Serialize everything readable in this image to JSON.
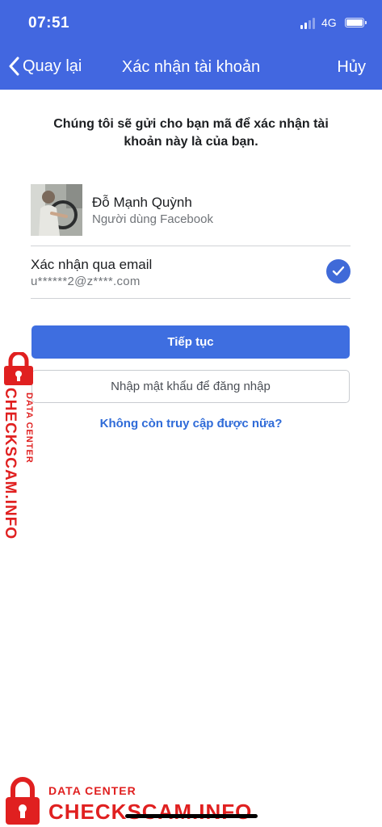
{
  "status_bar": {
    "time": "07:51",
    "network": "4G"
  },
  "nav": {
    "back_label": "Quay lại",
    "title": "Xác nhận tài khoản",
    "cancel_label": "Hủy"
  },
  "intro_text": "Chúng tôi sẽ gửi cho bạn mã để xác nhận tài khoản này là của bạn.",
  "account": {
    "name": "Đỗ Mạnh Quỳnh",
    "subtitle": "Người dùng Facebook"
  },
  "verify_option": {
    "title": "Xác nhận qua email",
    "email": "u******2@z****.com",
    "selected": true
  },
  "buttons": {
    "continue": "Tiếp tục",
    "password_login": "Nhập mật khẩu để đăng nhập"
  },
  "no_access_link": "Không còn truy cập được nữa?",
  "watermark": {
    "brand": "CHECKSCAM.INFO",
    "tagline": "DATA CENTER"
  },
  "colors": {
    "header": "#4267e0",
    "primary": "#3e6ee0",
    "link": "#2f6bd8",
    "watermark": "#e02020"
  }
}
